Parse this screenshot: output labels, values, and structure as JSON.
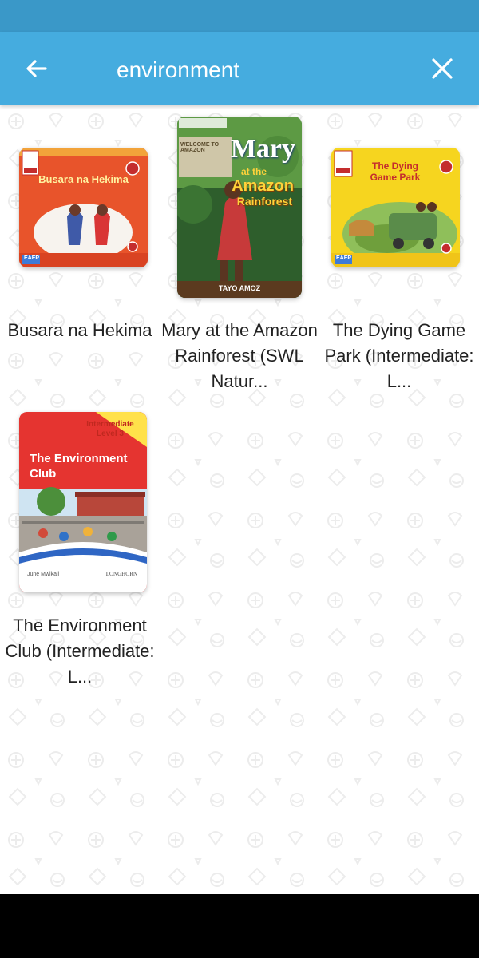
{
  "search": {
    "query": "environment"
  },
  "colors": {
    "status_bar": "#3a98c8",
    "app_bar": "#45acdf"
  },
  "icons": {
    "back": "back-arrow-icon",
    "close": "close-icon"
  },
  "books": [
    {
      "title": "Busara na Hekima",
      "cover": {
        "heading": "Busara na Hekima",
        "badge": "EAEP"
      }
    },
    {
      "title": "Mary at the Amazon Rainforest (SWL Natur...",
      "cover": {
        "heading_1": "Mary",
        "heading_2": "at the",
        "heading_3": "Amazon",
        "heading_4": "Rainforest",
        "author": "TAYO AMOZ",
        "sign": "WELCOME TO AMAZON"
      }
    },
    {
      "title": "The Dying Game Park (Intermediate: L...",
      "cover": {
        "heading_1": "The Dying",
        "heading_2": "Game Park",
        "badge": "EAEP"
      }
    },
    {
      "title": "The Environment Club (Intermediate: L...",
      "cover": {
        "level_1": "Intermediate",
        "level_2": "Level 3",
        "heading_1": "The Environment",
        "heading_2": "Club",
        "author": "June Mwikali",
        "publisher": "LONGHORN"
      }
    }
  ]
}
